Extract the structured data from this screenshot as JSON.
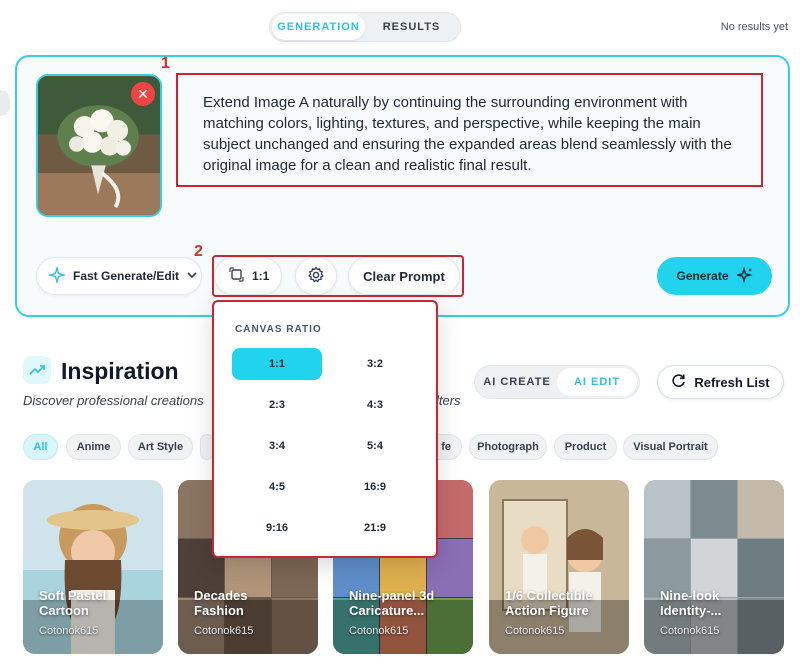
{
  "top_tabs": {
    "generation": "GENERATION",
    "results": "RESULTS"
  },
  "no_results": "No results yet",
  "markers": {
    "one": "1",
    "two": "2"
  },
  "prompt": "Extend Image A naturally by continuing the surrounding environment with matching colors, lighting, textures, and perspective, while keeping the main subject unchanged and ensuring the expanded areas blend seamlessly with the original image for a clean and realistic final result.",
  "toolbar": {
    "model_label": "Fast Generate/Edit",
    "ratio_label": "1:1",
    "clear_label": "Clear Prompt",
    "generate_label": "Generate"
  },
  "dropdown": {
    "title": "CANVAS RATIO",
    "options": [
      "1:1",
      "3:2",
      "2:3",
      "4:3",
      "3:4",
      "5:4",
      "4:5",
      "16:9",
      "9:16",
      "21:9"
    ],
    "selected": "1:1"
  },
  "inspiration": {
    "title": "Inspiration",
    "subtitle_left": "Discover professional creations",
    "subtitle_right": "lters",
    "mode_create": "AI CREATE",
    "mode_edit": "AI EDIT",
    "refresh": "Refresh List"
  },
  "chips": [
    "All",
    "Anime",
    "Art Style",
    "fe",
    "Photograph",
    "Product",
    "Visual Portrait"
  ],
  "cards": [
    {
      "title_line1": "Soft Pastel",
      "title_line2": "Cartoon",
      "author": "Cotonok615"
    },
    {
      "title_line1": "Decades",
      "title_line2": "Fashion",
      "author": "Cotonok615"
    },
    {
      "title_line1": "Nine-panel 3d",
      "title_line2": "Caricature...",
      "author": "Cotonok615"
    },
    {
      "title_line1": "1/6 Collectible",
      "title_line2": "Action Figure",
      "author": "Cotonok615"
    },
    {
      "title_line1": "Nine-look",
      "title_line2": "Identity-...",
      "author": "Cotonok615"
    }
  ],
  "colors": {
    "accent": "#22d3ee",
    "highlight_red": "#c62833",
    "close_red": "#ef4444"
  }
}
